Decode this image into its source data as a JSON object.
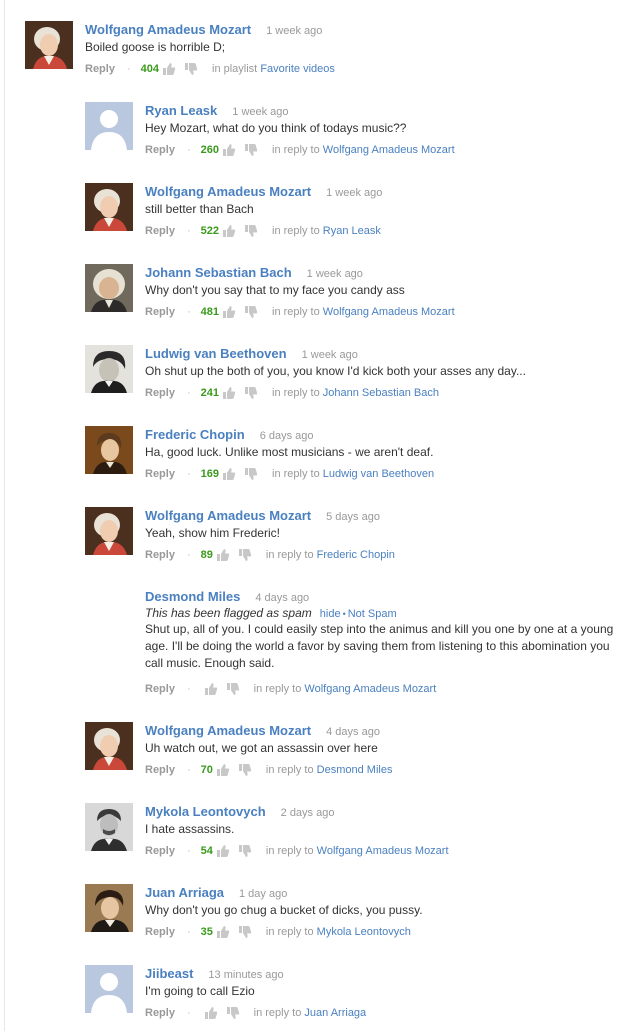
{
  "comments": [
    {
      "id": "c0",
      "avatar": "mozart",
      "author": "Wolfgang Amadeus Mozart",
      "time": "1 week ago",
      "text": "Boiled goose is horrible D;",
      "reply": "Reply",
      "votes": "404",
      "context_prefix": "in playlist",
      "context_link": "Favorite videos"
    },
    {
      "id": "c1",
      "avatar": "default",
      "author": "Ryan Leask",
      "time": "1 week ago",
      "text": "Hey Mozart, what do you think of todays music??",
      "reply": "Reply",
      "votes": "260",
      "context_prefix": "in reply to",
      "context_link": "Wolfgang Amadeus Mozart"
    },
    {
      "id": "c2",
      "avatar": "mozart",
      "author": "Wolfgang Amadeus Mozart",
      "time": "1 week ago",
      "text": "still better than Bach",
      "reply": "Reply",
      "votes": "522",
      "context_prefix": "in reply to",
      "context_link": "Ryan Leask"
    },
    {
      "id": "c3",
      "avatar": "bach",
      "author": "Johann Sebastian Bach",
      "time": "1 week ago",
      "text": "Why don't you say that to my face you candy ass",
      "reply": "Reply",
      "votes": "481",
      "context_prefix": "in reply to",
      "context_link": "Wolfgang Amadeus Mozart"
    },
    {
      "id": "c4",
      "avatar": "beethoven",
      "author": "Ludwig van Beethoven",
      "time": "1 week ago",
      "text": "Oh shut up the both of you, you know I'd kick both your asses any day...",
      "reply": "Reply",
      "votes": "241",
      "context_prefix": "in reply to",
      "context_link": "Johann Sebastian Bach"
    },
    {
      "id": "c5",
      "avatar": "chopin",
      "author": "Frederic Chopin",
      "time": "6 days ago",
      "text": "Ha, good luck. Unlike most musicians - we aren't deaf.",
      "reply": "Reply",
      "votes": "169",
      "context_prefix": "in reply to",
      "context_link": "Ludwig van Beethoven"
    },
    {
      "id": "c6",
      "avatar": "mozart",
      "author": "Wolfgang Amadeus Mozart",
      "time": "5 days ago",
      "text": "Yeah, show him Frederic!",
      "reply": "Reply",
      "votes": "89",
      "context_prefix": "in reply to",
      "context_link": "Frederic Chopin"
    },
    {
      "id": "c7",
      "avatar": "none",
      "author": "Desmond Miles",
      "time": "4 days ago",
      "flag_text": "This has been flagged as spam",
      "flag_hide": "hide",
      "flag_not_spam": "Not Spam",
      "text": "Shut up, all of you. I could easily step into the animus and kill you one by one at a young age. I'll be doing the world a favor by saving them from listening to this abomination you call music. Enough said.",
      "reply": "Reply",
      "votes": "",
      "context_prefix": "in reply to",
      "context_link": "Wolfgang Amadeus Mozart"
    },
    {
      "id": "c8",
      "avatar": "mozart",
      "author": "Wolfgang Amadeus Mozart",
      "time": "4 days ago",
      "text": "Uh watch out, we got an assassin over here",
      "reply": "Reply",
      "votes": "70",
      "context_prefix": "in reply to",
      "context_link": "Desmond Miles"
    },
    {
      "id": "c9",
      "avatar": "leontovych",
      "author": "Mykola Leontovych",
      "time": "2 days ago",
      "text": "I hate assassins.",
      "reply": "Reply",
      "votes": "54",
      "context_prefix": "in reply to",
      "context_link": "Wolfgang Amadeus Mozart"
    },
    {
      "id": "c10",
      "avatar": "arriaga",
      "author": "Juan Arriaga",
      "time": "1 day ago",
      "text": "Why don't you go chug a bucket of dicks, you pussy.",
      "reply": "Reply",
      "votes": "35",
      "context_prefix": "in reply to",
      "context_link": "Mykola Leontovych"
    },
    {
      "id": "c11",
      "avatar": "default",
      "author": "Jiibeast",
      "time": "13 minutes ago",
      "text": "I'm going to call Ezio",
      "reply": "Reply",
      "votes": "",
      "context_prefix": "in reply to",
      "context_link": "Juan Arriaga"
    }
  ],
  "separator": "·",
  "colors": {
    "author": "#4a80c0",
    "votes": "#3a9a1c",
    "muted": "#999999",
    "text": "#333333"
  }
}
